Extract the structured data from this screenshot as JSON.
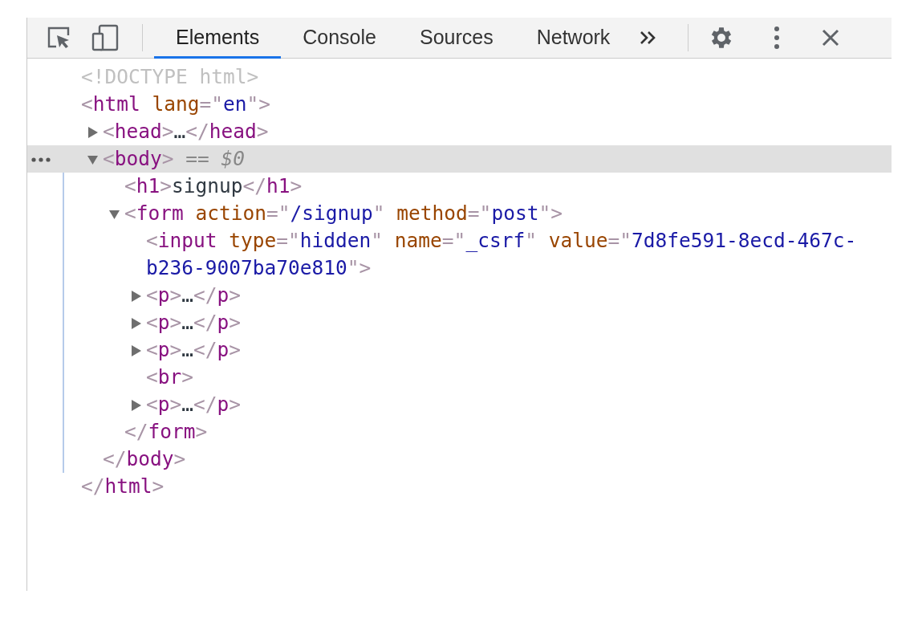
{
  "toolbar": {
    "tabs": [
      {
        "label": "Elements",
        "selected": true
      },
      {
        "label": "Console",
        "selected": false
      },
      {
        "label": "Sources",
        "selected": false
      },
      {
        "label": "Network",
        "selected": false
      }
    ]
  },
  "tree": [
    {
      "open": [
        {
          "kind": "doctype",
          "text": "<!DOCTYPE html>"
        }
      ],
      "selected": false
    },
    {
      "open": [
        {
          "kind": "punct",
          "text": "<"
        },
        {
          "kind": "tag",
          "text": "html"
        },
        {
          "kind": "attr",
          "text": " lang"
        },
        {
          "kind": "punct",
          "text": "=\""
        },
        {
          "kind": "value",
          "text": "en"
        },
        {
          "kind": "punct",
          "text": "\">"
        }
      ],
      "selected": false,
      "close": [
        {
          "kind": "punct",
          "text": "</"
        },
        {
          "kind": "tag",
          "text": "html"
        },
        {
          "kind": "punct",
          "text": ">"
        }
      ],
      "children": [
        {
          "open": [
            {
              "kind": "punct",
              "text": "<"
            },
            {
              "kind": "tag",
              "text": "head"
            },
            {
              "kind": "punct",
              "text": ">"
            },
            {
              "kind": "ellipsis",
              "text": "…"
            },
            {
              "kind": "punct",
              "text": "</"
            },
            {
              "kind": "tag",
              "text": "head"
            },
            {
              "kind": "punct",
              "text": ">"
            }
          ],
          "selected": false,
          "expanded": false
        },
        {
          "open": [
            {
              "kind": "punct",
              "text": "<"
            },
            {
              "kind": "tag",
              "text": "body"
            },
            {
              "kind": "punct",
              "text": ">"
            },
            {
              "kind": "note",
              "text": " == "
            },
            {
              "kind": "ref",
              "text": "$0"
            }
          ],
          "selected": true,
          "expanded": true,
          "close": [
            {
              "kind": "punct",
              "text": "</"
            },
            {
              "kind": "tag",
              "text": "body"
            },
            {
              "kind": "punct",
              "text": ">"
            }
          ],
          "children": [
            {
              "open": [
                {
                  "kind": "punct",
                  "text": "<"
                },
                {
                  "kind": "tag",
                  "text": "h1"
                },
                {
                  "kind": "punct",
                  "text": ">"
                },
                {
                  "kind": "text",
                  "text": "signup"
                },
                {
                  "kind": "punct",
                  "text": "</"
                },
                {
                  "kind": "tag",
                  "text": "h1"
                },
                {
                  "kind": "punct",
                  "text": ">"
                }
              ],
              "selected": false
            },
            {
              "open": [
                {
                  "kind": "punct",
                  "text": "<"
                },
                {
                  "kind": "tag",
                  "text": "form"
                },
                {
                  "kind": "attr",
                  "text": " action"
                },
                {
                  "kind": "punct",
                  "text": "=\""
                },
                {
                  "kind": "value",
                  "text": "/signup"
                },
                {
                  "kind": "punct",
                  "text": "\""
                },
                {
                  "kind": "attr",
                  "text": " method"
                },
                {
                  "kind": "punct",
                  "text": "=\""
                },
                {
                  "kind": "value",
                  "text": "post"
                },
                {
                  "kind": "punct",
                  "text": "\">"
                }
              ],
              "selected": false,
              "expanded": true,
              "close": [
                {
                  "kind": "punct",
                  "text": "</"
                },
                {
                  "kind": "tag",
                  "text": "form"
                },
                {
                  "kind": "punct",
                  "text": ">"
                }
              ],
              "children": [
                {
                  "open": [
                    {
                      "kind": "punct",
                      "text": "<"
                    },
                    {
                      "kind": "tag",
                      "text": "input"
                    },
                    {
                      "kind": "attr",
                      "text": " type"
                    },
                    {
                      "kind": "punct",
                      "text": "=\""
                    },
                    {
                      "kind": "value",
                      "text": "hidden"
                    },
                    {
                      "kind": "punct",
                      "text": "\""
                    },
                    {
                      "kind": "attr",
                      "text": " name"
                    },
                    {
                      "kind": "punct",
                      "text": "=\""
                    },
                    {
                      "kind": "value",
                      "text": "_csrf"
                    },
                    {
                      "kind": "punct",
                      "text": "\""
                    },
                    {
                      "kind": "attr",
                      "text": " value"
                    },
                    {
                      "kind": "punct",
                      "text": "=\""
                    },
                    {
                      "kind": "value",
                      "text": "7d8fe591-8ecd-467c-b236-9007ba70e810"
                    },
                    {
                      "kind": "punct",
                      "text": "\">"
                    }
                  ],
                  "selected": false
                },
                {
                  "open": [
                    {
                      "kind": "punct",
                      "text": "<"
                    },
                    {
                      "kind": "tag",
                      "text": "p"
                    },
                    {
                      "kind": "punct",
                      "text": ">"
                    },
                    {
                      "kind": "ellipsis",
                      "text": "…"
                    },
                    {
                      "kind": "punct",
                      "text": "</"
                    },
                    {
                      "kind": "tag",
                      "text": "p"
                    },
                    {
                      "kind": "punct",
                      "text": ">"
                    }
                  ],
                  "selected": false,
                  "expanded": false
                },
                {
                  "open": [
                    {
                      "kind": "punct",
                      "text": "<"
                    },
                    {
                      "kind": "tag",
                      "text": "p"
                    },
                    {
                      "kind": "punct",
                      "text": ">"
                    },
                    {
                      "kind": "ellipsis",
                      "text": "…"
                    },
                    {
                      "kind": "punct",
                      "text": "</"
                    },
                    {
                      "kind": "tag",
                      "text": "p"
                    },
                    {
                      "kind": "punct",
                      "text": ">"
                    }
                  ],
                  "selected": false,
                  "expanded": false
                },
                {
                  "open": [
                    {
                      "kind": "punct",
                      "text": "<"
                    },
                    {
                      "kind": "tag",
                      "text": "p"
                    },
                    {
                      "kind": "punct",
                      "text": ">"
                    },
                    {
                      "kind": "ellipsis",
                      "text": "…"
                    },
                    {
                      "kind": "punct",
                      "text": "</"
                    },
                    {
                      "kind": "tag",
                      "text": "p"
                    },
                    {
                      "kind": "punct",
                      "text": ">"
                    }
                  ],
                  "selected": false,
                  "expanded": false
                },
                {
                  "open": [
                    {
                      "kind": "punct",
                      "text": "<"
                    },
                    {
                      "kind": "tag",
                      "text": "br"
                    },
                    {
                      "kind": "punct",
                      "text": ">"
                    }
                  ],
                  "selected": false
                },
                {
                  "open": [
                    {
                      "kind": "punct",
                      "text": "<"
                    },
                    {
                      "kind": "tag",
                      "text": "p"
                    },
                    {
                      "kind": "punct",
                      "text": ">"
                    },
                    {
                      "kind": "ellipsis",
                      "text": "…"
                    },
                    {
                      "kind": "punct",
                      "text": "</"
                    },
                    {
                      "kind": "tag",
                      "text": "p"
                    },
                    {
                      "kind": "punct",
                      "text": ">"
                    }
                  ],
                  "selected": false,
                  "expanded": false
                }
              ]
            }
          ]
        }
      ]
    }
  ]
}
